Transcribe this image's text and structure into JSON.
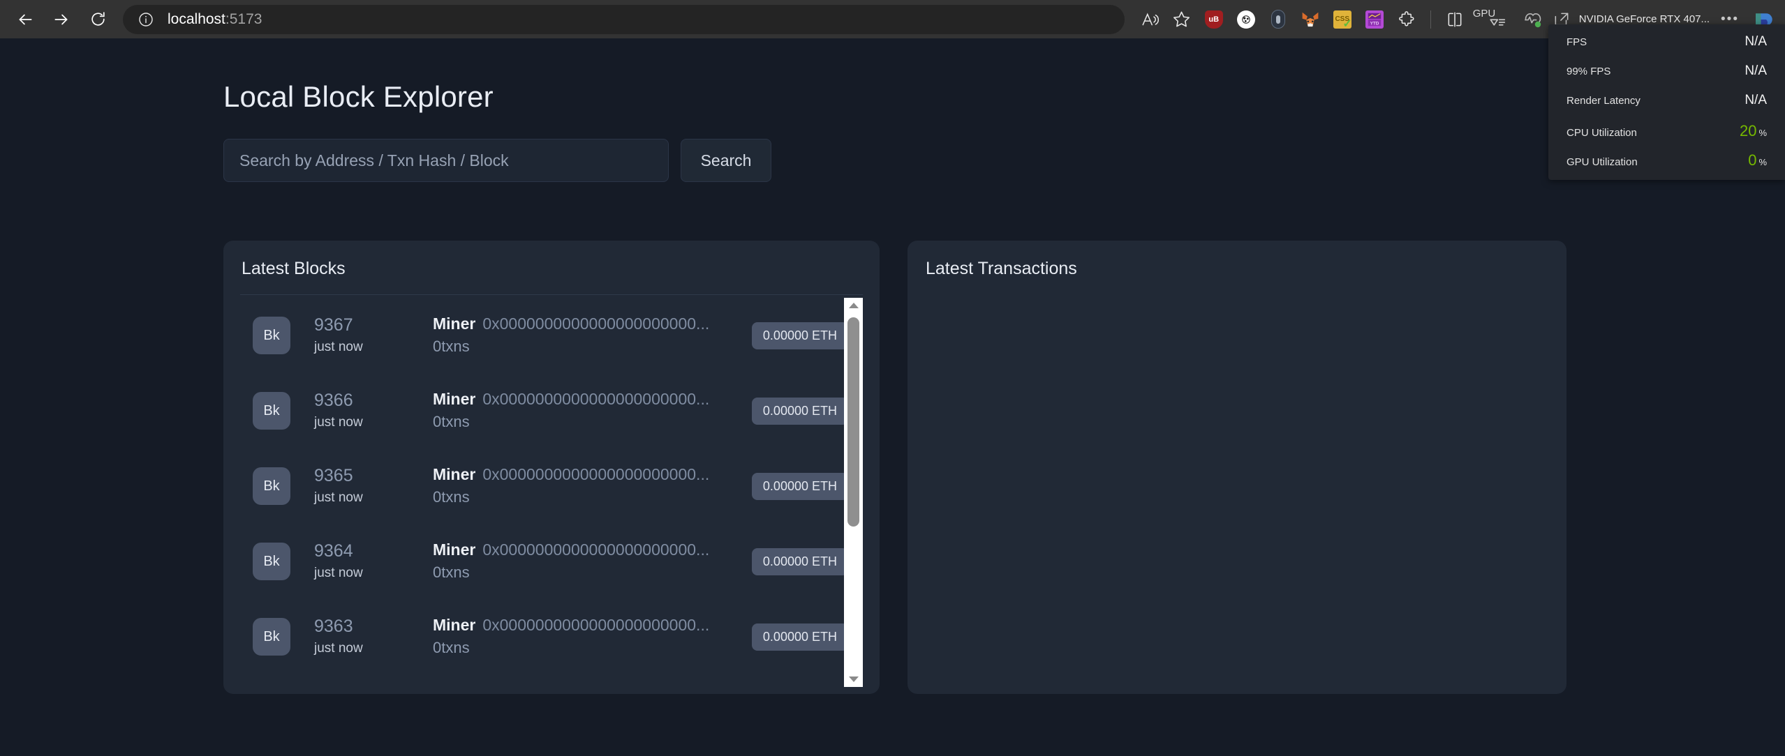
{
  "browser": {
    "back_label": "Back",
    "forward_label": "Forward",
    "reload_label": "Refresh",
    "url_host": "localhost",
    "url_port": ":5173",
    "read_aloud_label": "Read aloud",
    "favorite_label": "Add to favorites",
    "extensions": [
      {
        "name": "ublock-origin",
        "label": "uB",
        "color": "#a01e20"
      },
      {
        "name": "white-circle-extension",
        "label": "",
        "color": "#ffffff"
      },
      {
        "name": "dark-pill-extension",
        "label": "",
        "color": "#2c3440"
      },
      {
        "name": "metamask",
        "label": "",
        "color": "#d97b3f"
      },
      {
        "name": "css-validator",
        "label": "CSS",
        "color": "#e0b33a"
      },
      {
        "name": "purple-chart-extension",
        "label": "",
        "color": "#b44ad6"
      }
    ],
    "puzzle_label": "Extensions",
    "split_screen_label": "Split screen",
    "gpu_button_label": "GPU",
    "performance_label": "Performance",
    "nvidia_label": "NVIDIA GeForce RTX 407...",
    "settings_dots": "•••",
    "profile_label": "Profile"
  },
  "gpu_overlay": {
    "rows": [
      {
        "label": "FPS",
        "value": "N/A",
        "unit": "",
        "green": false
      },
      {
        "label": "99% FPS",
        "value": "N/A",
        "unit": "",
        "green": false
      },
      {
        "label": "Render Latency",
        "value": "N/A",
        "unit": "",
        "green": false
      },
      {
        "label": "CPU Utilization",
        "value": "20",
        "unit": "%",
        "green": true
      },
      {
        "label": "GPU Utilization",
        "value": "0",
        "unit": "%",
        "green": true
      }
    ]
  },
  "app": {
    "title": "Local Block Explorer",
    "search": {
      "placeholder": "Search by Address / Txn Hash / Block",
      "value": "",
      "button_label": "Search"
    },
    "blocks_panel": {
      "title": "Latest Blocks",
      "rows": [
        {
          "avatar": "Bk",
          "number": "9367",
          "time": "just now",
          "miner_label": "Miner",
          "miner_address": "0x0000000000000000000000...",
          "txns": "0txns",
          "value": "0.00000 ETH"
        },
        {
          "avatar": "Bk",
          "number": "9366",
          "time": "just now",
          "miner_label": "Miner",
          "miner_address": "0x0000000000000000000000...",
          "txns": "0txns",
          "value": "0.00000 ETH"
        },
        {
          "avatar": "Bk",
          "number": "9365",
          "time": "just now",
          "miner_label": "Miner",
          "miner_address": "0x0000000000000000000000...",
          "txns": "0txns",
          "value": "0.00000 ETH"
        },
        {
          "avatar": "Bk",
          "number": "9364",
          "time": "just now",
          "miner_label": "Miner",
          "miner_address": "0x0000000000000000000000...",
          "txns": "0txns",
          "value": "0.00000 ETH"
        },
        {
          "avatar": "Bk",
          "number": "9363",
          "time": "just now",
          "miner_label": "Miner",
          "miner_address": "0x0000000000000000000000...",
          "txns": "0txns",
          "value": "0.00000 ETH"
        }
      ]
    },
    "transactions_panel": {
      "title": "Latest Transactions",
      "rows": []
    }
  },
  "colors": {
    "page_bg": "#151b26",
    "panel_bg": "#212936",
    "accent_green": "#76b900",
    "avatar_bg": "#4c566b"
  }
}
